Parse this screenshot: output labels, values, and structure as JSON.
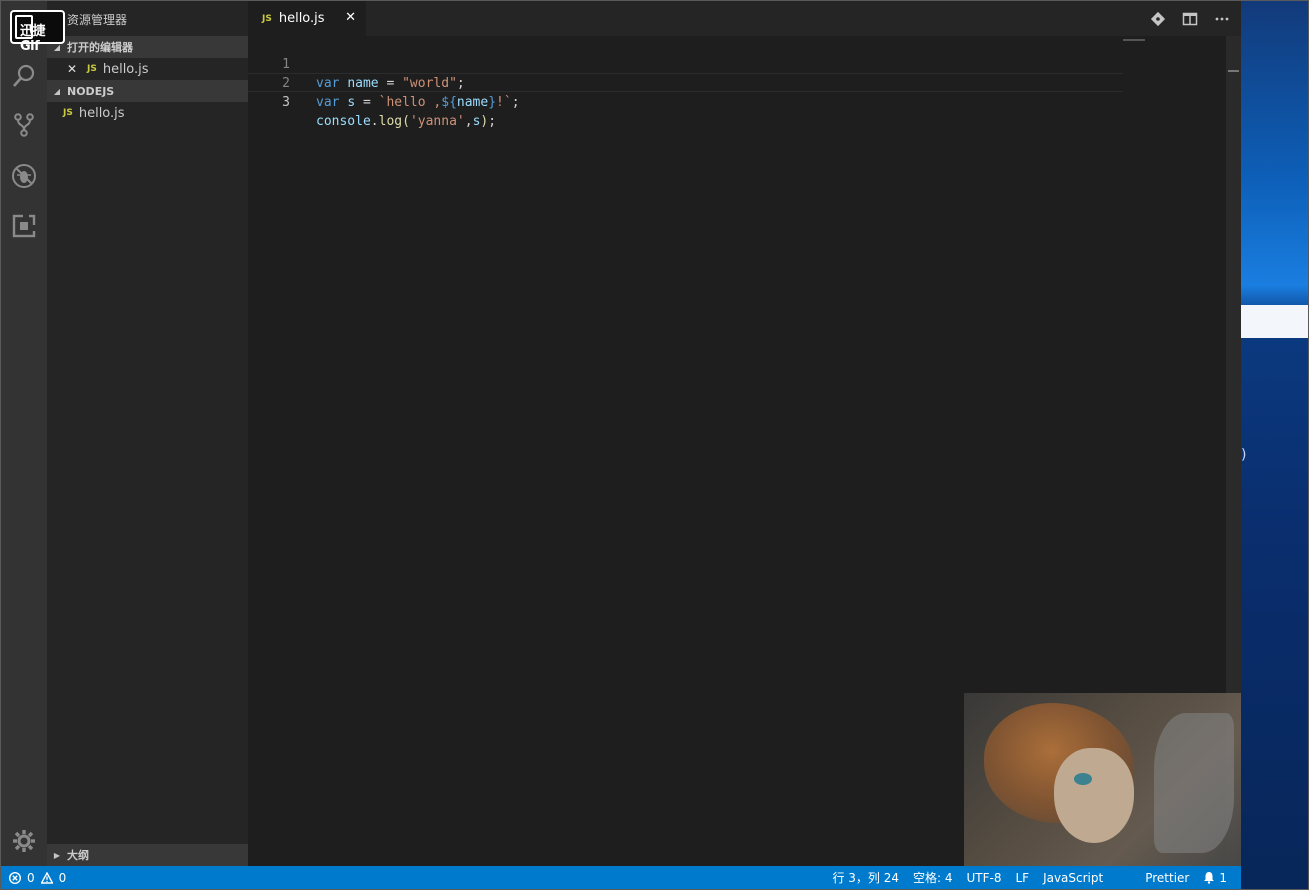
{
  "badge": {
    "label": "迅捷Gif"
  },
  "explorer": {
    "title": "资源管理器",
    "open_editors_label": "打开的编辑器",
    "open_files": [
      {
        "close_glyph": "✕",
        "badge": "JS",
        "name": "hello.js"
      }
    ],
    "folder_label": "NODEJS",
    "tree_files": [
      {
        "badge": "JS",
        "name": "hello.js"
      }
    ],
    "outline_label": "大纲"
  },
  "tabs": [
    {
      "badge": "JS",
      "label": "hello.js",
      "close_glyph": "✕",
      "active": true
    }
  ],
  "editor": {
    "lines": [
      {
        "number": "1",
        "tokens": [
          [
            "kw",
            "var"
          ],
          [
            "op",
            " "
          ],
          [
            "id",
            "name"
          ],
          [
            "op",
            " = "
          ],
          [
            "str",
            "\"world\""
          ],
          [
            "op",
            ";"
          ]
        ]
      },
      {
        "number": "2",
        "tokens": [
          [
            "kw",
            "var"
          ],
          [
            "op",
            " "
          ],
          [
            "id",
            "s"
          ],
          [
            "op",
            " = "
          ],
          [
            "str",
            "`hello ,"
          ],
          [
            "kw",
            "${"
          ],
          [
            "id",
            "name"
          ],
          [
            "kw",
            "}"
          ],
          [
            "str",
            "!`"
          ],
          [
            "op",
            ";"
          ]
        ]
      },
      {
        "number": "3",
        "tokens": [
          [
            "id",
            "console"
          ],
          [
            "op",
            "."
          ],
          [
            "fn",
            "log"
          ],
          [
            "fn",
            "("
          ],
          [
            "str",
            "'yanna'"
          ],
          [
            "op",
            ","
          ],
          [
            "id",
            "s"
          ],
          [
            "fn",
            ")"
          ],
          [
            "op",
            ";"
          ]
        ]
      }
    ],
    "current_line": 3
  },
  "status": {
    "errors": "0",
    "warnings": "0",
    "cursor": "行 3，列 24",
    "indent": "空格: 4",
    "encoding": "UTF-8",
    "eol": "LF",
    "language": "JavaScript",
    "formatter": "Prettier",
    "notifications": "1"
  },
  "desktop": {
    "mark": ")"
  },
  "colors": {
    "status_bar": "#007acc",
    "keyword": "#569cd6",
    "identifier": "#9cdcfe",
    "string": "#ce9178",
    "function": "#dcdcaa",
    "js_badge": "#cbcb41"
  },
  "icons": [
    "search-icon",
    "source-control-icon",
    "debug-icon",
    "extensions-icon",
    "gear-icon",
    "open-changes-icon",
    "split-editor-icon",
    "more-actions-icon",
    "error-icon",
    "warning-icon",
    "bell-icon"
  ]
}
